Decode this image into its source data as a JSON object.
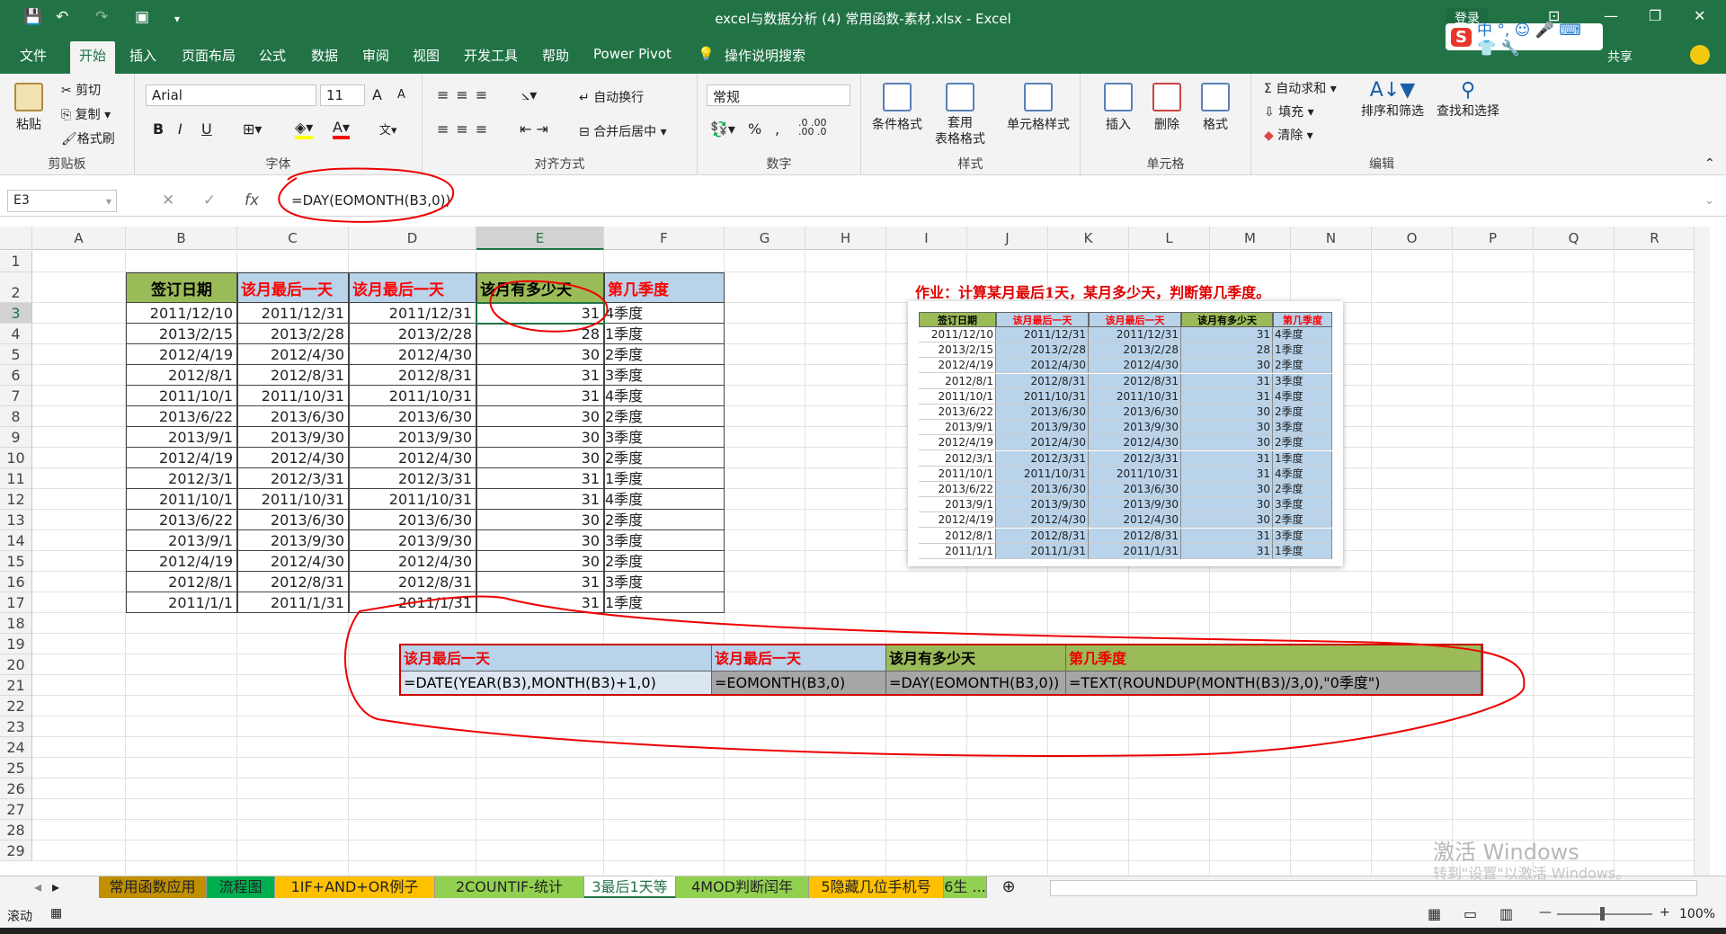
{
  "window": {
    "title": "excel与数据分析 (4) 常用函数-素材.xlsx  -  Excel",
    "login": "登录",
    "share": "共享"
  },
  "ime": {
    "logo": "S",
    "glyphs": "中 °, ☺ 🎤 ⌨ 👕 🔧"
  },
  "tabs": [
    "文件",
    "开始",
    "插入",
    "页面布局",
    "公式",
    "数据",
    "审阅",
    "视图",
    "开发工具",
    "帮助",
    "Power Pivot",
    "操作说明搜索"
  ],
  "active_tab": "开始",
  "ribbon": {
    "clipboard": {
      "label": "剪贴板",
      "paste": "粘贴",
      "cut": "剪切",
      "copy": "复制",
      "painter": "格式刷"
    },
    "font": {
      "label": "字体",
      "name": "Arial",
      "size": "11",
      "bold": "B",
      "italic": "I",
      "underline": "U",
      "grow": "A",
      "shrink": "A",
      "wen": "文"
    },
    "align": {
      "label": "对齐方式",
      "wrap": "自动换行",
      "merge": "合并后居中"
    },
    "number": {
      "label": "数字",
      "format": "常规",
      "pct": "%",
      "comma": ","
    },
    "styles": {
      "label": "样式",
      "cond": "条件格式",
      "table1": "套用",
      "table2": "表格格式",
      "cell": "单元格样式"
    },
    "cells": {
      "label": "单元格",
      "insert": "插入",
      "delete": "删除",
      "format": "格式"
    },
    "edit": {
      "label": "编辑",
      "autosum": "自动求和",
      "fill": "填充",
      "clear": "清除",
      "sort": "排序和筛选",
      "find": "查找和选择"
    }
  },
  "formula_bar": {
    "name_box": "E3",
    "formula": "=DAY(EOMONTH(B3,0))",
    "fx": "fx"
  },
  "columns": [
    "A",
    "B",
    "C",
    "D",
    "E",
    "F",
    "G",
    "H",
    "I",
    "J",
    "K",
    "L",
    "M",
    "N",
    "O",
    "P",
    "Q",
    "R"
  ],
  "rows": [
    "1",
    "2",
    "3",
    "4",
    "5",
    "6",
    "7",
    "8",
    "9",
    "10",
    "11",
    "12",
    "13",
    "14",
    "15",
    "16",
    "17",
    "18",
    "19",
    "20",
    "21",
    "22",
    "23",
    "24",
    "25",
    "26",
    "27",
    "28",
    "29"
  ],
  "table": {
    "headers": [
      "签订日期",
      "该月最后一天",
      "该月最后一天",
      "该月有多少天",
      "第几季度"
    ],
    "rows": [
      [
        "2011/12/10",
        "2011/12/31",
        "2011/12/31",
        "31",
        "4季度"
      ],
      [
        "2013/2/15",
        "2013/2/28",
        "2013/2/28",
        "28",
        "1季度"
      ],
      [
        "2012/4/19",
        "2012/4/30",
        "2012/4/30",
        "30",
        "2季度"
      ],
      [
        "2012/8/1",
        "2012/8/31",
        "2012/8/31",
        "31",
        "3季度"
      ],
      [
        "2011/10/1",
        "2011/10/31",
        "2011/10/31",
        "31",
        "4季度"
      ],
      [
        "2013/6/22",
        "2013/6/30",
        "2013/6/30",
        "30",
        "2季度"
      ],
      [
        "2013/9/1",
        "2013/9/30",
        "2013/9/30",
        "30",
        "3季度"
      ],
      [
        "2012/4/19",
        "2012/4/30",
        "2012/4/30",
        "30",
        "2季度"
      ],
      [
        "2012/3/1",
        "2012/3/31",
        "2012/3/31",
        "31",
        "1季度"
      ],
      [
        "2011/10/1",
        "2011/10/31",
        "2011/10/31",
        "31",
        "4季度"
      ],
      [
        "2013/6/22",
        "2013/6/30",
        "2013/6/30",
        "30",
        "2季度"
      ],
      [
        "2013/9/1",
        "2013/9/30",
        "2013/9/30",
        "30",
        "3季度"
      ],
      [
        "2012/4/19",
        "2012/4/30",
        "2012/4/30",
        "30",
        "2季度"
      ],
      [
        "2012/8/1",
        "2012/8/31",
        "2012/8/31",
        "31",
        "3季度"
      ],
      [
        "2011/1/1",
        "2011/1/31",
        "2011/1/31",
        "31",
        "1季度"
      ]
    ]
  },
  "note": "作业：计算某月最后1天，某月多少天，判断第几季度。",
  "thumbnail": {
    "headers": [
      "签订日期",
      "该月最后一天",
      "该月最后一天",
      "该月有多少天",
      "第几季度"
    ],
    "rows": [
      [
        "2011/12/10",
        "2011/12/31",
        "2011/12/31",
        "31",
        "4季度"
      ],
      [
        "2013/2/15",
        "2013/2/28",
        "2013/2/28",
        "28",
        "1季度"
      ],
      [
        "2012/4/19",
        "2012/4/30",
        "2012/4/30",
        "30",
        "2季度"
      ],
      [
        "2012/8/1",
        "2012/8/31",
        "2012/8/31",
        "31",
        "3季度"
      ],
      [
        "2011/10/1",
        "2011/10/31",
        "2011/10/31",
        "31",
        "4季度"
      ],
      [
        "2013/6/22",
        "2013/6/30",
        "2013/6/30",
        "30",
        "2季度"
      ],
      [
        "2013/9/1",
        "2013/9/30",
        "2013/9/30",
        "30",
        "3季度"
      ],
      [
        "2012/4/19",
        "2012/4/30",
        "2012/4/30",
        "30",
        "2季度"
      ],
      [
        "2012/3/1",
        "2012/3/31",
        "2012/3/31",
        "31",
        "1季度"
      ],
      [
        "2011/10/1",
        "2011/10/31",
        "2011/10/31",
        "31",
        "4季度"
      ],
      [
        "2013/6/22",
        "2013/6/30",
        "2013/6/30",
        "30",
        "2季度"
      ],
      [
        "2013/9/1",
        "2013/9/30",
        "2013/9/30",
        "30",
        "3季度"
      ],
      [
        "2012/4/19",
        "2012/4/30",
        "2012/4/30",
        "30",
        "2季度"
      ],
      [
        "2012/8/1",
        "2012/8/31",
        "2012/8/31",
        "31",
        "3季度"
      ],
      [
        "2011/1/1",
        "2011/1/31",
        "2011/1/31",
        "31",
        "1季度"
      ]
    ]
  },
  "formula_table": {
    "headers": [
      "该月最后一天",
      "该月最后一天",
      "该月有多少天",
      "第几季度"
    ],
    "formulas": [
      "=DATE(YEAR(B3),MONTH(B3)+1,0)",
      "=EOMONTH(B3,0)",
      "=DAY(EOMONTH(B3,0))",
      "=TEXT(ROUNDUP(MONTH(B3)/3,0),\"0季度\")"
    ]
  },
  "sheet_tabs": [
    {
      "label": "常用函数应用",
      "color": "#c09000"
    },
    {
      "label": "流程图",
      "color": "#00b050"
    },
    {
      "label": "1IF+AND+OR例子",
      "color": "#ffc000"
    },
    {
      "label": "2COUNTIF-统计",
      "color": "#92d050"
    },
    {
      "label": "3最后1天等",
      "color": "#ffffff"
    },
    {
      "label": "4MOD判断闰年",
      "color": "#92d050"
    },
    {
      "label": "5隐藏几位手机号",
      "color": "#ffc000"
    },
    {
      "label": "6生 ...",
      "color": "#92d050"
    }
  ],
  "status": {
    "mode": "滚动",
    "zoom": "100%"
  },
  "watermark": {
    "line1": "激活 Windows",
    "line2": "转到\"设置\"以激活 Windows。"
  },
  "colors": {
    "excel_green": "#217346",
    "header_green": "#9bbb59",
    "header_blue": "#b8d3ea",
    "red_text": "#ff0000",
    "ink": "#e00000"
  }
}
